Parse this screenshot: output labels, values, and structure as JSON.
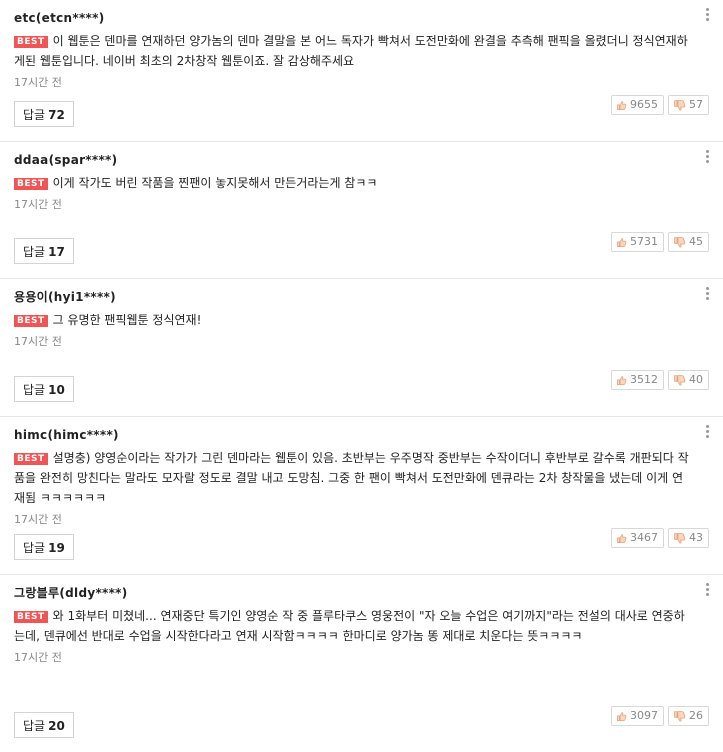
{
  "badge": "BEST",
  "time_default": "17시간 전",
  "reply_label": "답글",
  "colors": {
    "best_badge": "#f05454",
    "vote_icon": "#e8a07a"
  },
  "comments": [
    {
      "user": "etc(etcn****)",
      "text": "이 웹툰은 덴마를 연재하던 양가놈의 덴마 결말을 본 어느 독자가 빡쳐서 도전만화에 완결을 추측해 팬픽을 올렸더니 정식연재하게된 웹툰입니다. 네이버 최초의 2차창작 웹툰이죠. 잘 감상해주세요",
      "time": "17시간 전",
      "replies": "72",
      "likes": "9655",
      "dislikes": "57"
    },
    {
      "user": "ddaa(spar****)",
      "text": "이게 작가도 버린 작품을 찐팬이 놓지못해서 만든거라는게 참ㅋㅋ",
      "time": "17시간 전",
      "replies": "17",
      "likes": "5731",
      "dislikes": "45"
    },
    {
      "user": "용용이(hyi1****)",
      "text": "그 유명한 팬픽웹툰 정식연재!",
      "time": "17시간 전",
      "replies": "10",
      "likes": "3512",
      "dislikes": "40"
    },
    {
      "user": "himc(himc****)",
      "text": "설명충) 양영순이라는 작가가 그린 덴마라는 웹툰이 있음. 초반부는 우주명작 중반부는 수작이더니 후반부로 갈수록 개판되다 작품을 완전히 망친다는 말라도 모자랄 정도로 결말 내고 도망침. 그중 한 팬이 빡쳐서 도전만화에 덴큐라는 2차 창작물을 냈는데 이게 연재됨 ㅋㅋㅋㅋㅋㅋ",
      "time": "17시간 전",
      "replies": "19",
      "likes": "3467",
      "dislikes": "43"
    },
    {
      "user": "그랑블루(dldy****)",
      "text": "와 1화부터 미쳤네... 연재중단 특기인 양영순 작 중 플루타쿠스 영웅전이 \"자 오늘 수업은 여기까지\"라는 전설의 대사로 연중하는데, 덴큐에선 반대로 수업을 시작한다라고 연재 시작함ㅋㅋㅋㅋ 한마디로 양가놈 똥 제대로 치운다는 뜻ㅋㅋㅋㅋ",
      "time": "17시간 전",
      "replies": "20",
      "likes": "3097",
      "dislikes": "26"
    }
  ]
}
